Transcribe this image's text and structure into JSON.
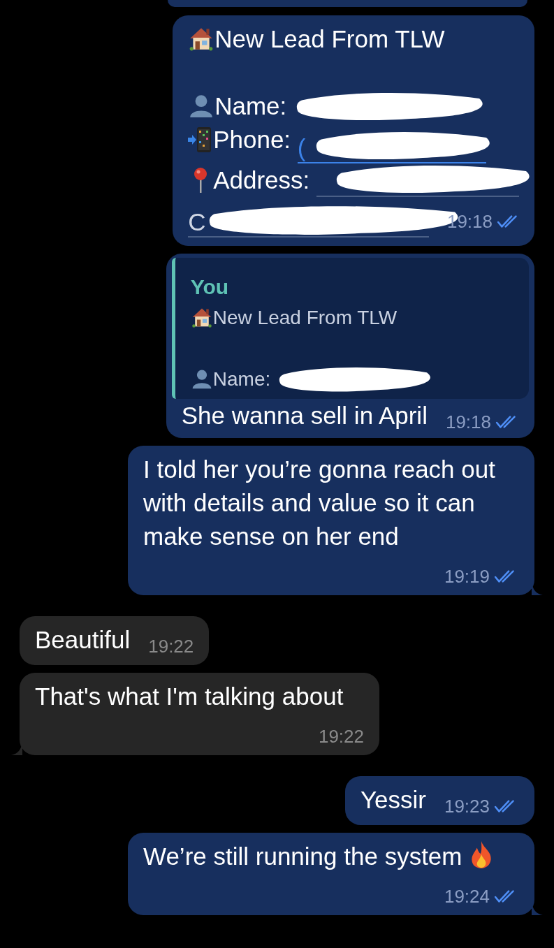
{
  "messages": [
    {
      "kind": "clipped",
      "outgoing": true
    },
    {
      "kind": "lead",
      "outgoing": true,
      "title": "New Lead From TLW",
      "fields": [
        {
          "kind": "name",
          "label": "Name:",
          "redacted": true
        },
        {
          "kind": "phone",
          "label": "Phone:",
          "value": "(",
          "redacted": true
        },
        {
          "kind": "address",
          "label": "Address:",
          "value": "C",
          "redacted": true
        }
      ],
      "time": "19:18",
      "read": true,
      "tail": false
    },
    {
      "kind": "reply",
      "outgoing": true,
      "quote": {
        "author": "You",
        "title": "New Lead From TLW",
        "fields": [
          {
            "kind": "name",
            "label": "Name:",
            "redacted": true
          }
        ]
      },
      "text": "She wanna sell in April",
      "time": "19:18",
      "read": true,
      "tail": false
    },
    {
      "kind": "text",
      "outgoing": true,
      "text": "I told her you’re gonna reach out with details and value so it can make sense on her end",
      "time": "19:19",
      "read": true,
      "tail": true
    },
    {
      "kind": "text",
      "outgoing": false,
      "text": "Beautiful",
      "time": "19:22",
      "tail": false
    },
    {
      "kind": "text",
      "outgoing": false,
      "text": "That's what I'm talking about",
      "time": "19:22",
      "tail": true
    },
    {
      "kind": "text",
      "outgoing": true,
      "text": "Yessir",
      "time": "19:23",
      "read": true,
      "tail": false
    },
    {
      "kind": "text",
      "outgoing": true,
      "text": "We’re still running the system",
      "fire": true,
      "time": "19:24",
      "read": true,
      "tail": true
    }
  ]
}
